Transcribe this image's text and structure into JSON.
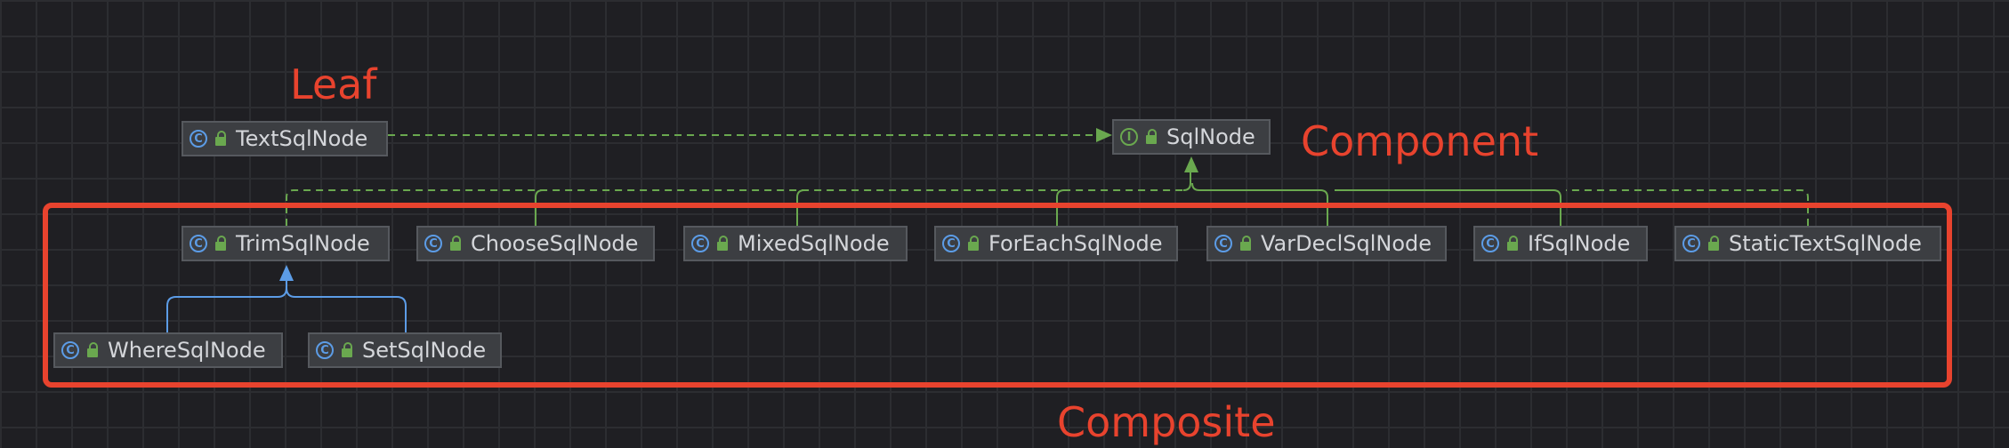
{
  "annotations": {
    "leaf": "Leaf",
    "component": "Component",
    "composite": "Composite"
  },
  "nodes": {
    "text_sql_node": "TextSqlNode",
    "sql_node": "SqlNode",
    "trim_sql_node": "TrimSqlNode",
    "choose_sql_node": "ChooseSqlNode",
    "mixed_sql_node": "MixedSqlNode",
    "for_each_sql_node": "ForEachSqlNode",
    "var_decl_sql_node": "VarDeclSqlNode",
    "if_sql_node": "IfSqlNode",
    "static_text_sql_node": "StaticTextSqlNode",
    "where_sql_node": "WhereSqlNode",
    "set_sql_node": "SetSqlNode"
  },
  "icons": {
    "class_glyph": "C",
    "interface_glyph": "I"
  },
  "colors": {
    "annotation_red": "#e8432e",
    "implements_green": "#6aa84f",
    "extends_blue": "#5c9ce6",
    "dashed_dependency": "#6aa84f"
  }
}
